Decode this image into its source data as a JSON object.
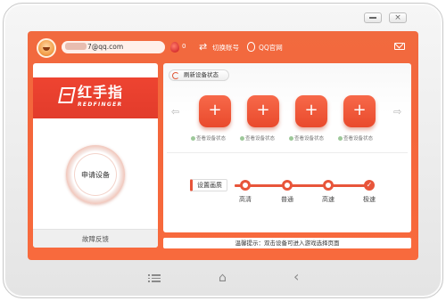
{
  "topbar": {
    "account": "7@qq.com",
    "gem_count": "0",
    "switch_account": "切换账号",
    "qq_group": "QQ官网"
  },
  "brand": {
    "name": "红手指",
    "subtitle": "REDFINGER"
  },
  "left_panel": {
    "apply_button": "申请设备",
    "feedback": "故障反馈"
  },
  "devices": {
    "refresh_label": "刷新设备状态",
    "slot_symbol": "+",
    "slots": [
      {
        "status": "查看设备状态"
      },
      {
        "status": "查看设备状态"
      },
      {
        "status": "查看设备状态"
      },
      {
        "status": "查看设备状态"
      }
    ]
  },
  "quality": {
    "label": "设置画质",
    "options": [
      "高清",
      "普通",
      "高速",
      "极速"
    ],
    "selected": "极速"
  },
  "tip": "温馨提示：双击设备可进入游戏选择页面",
  "colors": {
    "accent": "#f4663b",
    "brand_red": "#e23b2b",
    "status_green": "#9ec99b"
  },
  "icons": {
    "minimize": "minimize-icon",
    "close": "close-icon",
    "switch": "switch-account-icon",
    "qq": "qq-icon",
    "mail": "mail-icon",
    "refresh": "refresh-icon",
    "menu": "menu-icon",
    "home": "home-icon",
    "back": "back-icon"
  },
  "glyphs": {
    "close": "×",
    "switch": "⇄",
    "arrow_left": "⇦",
    "arrow_right": "⇨",
    "home": "⌂",
    "back": "‹"
  }
}
